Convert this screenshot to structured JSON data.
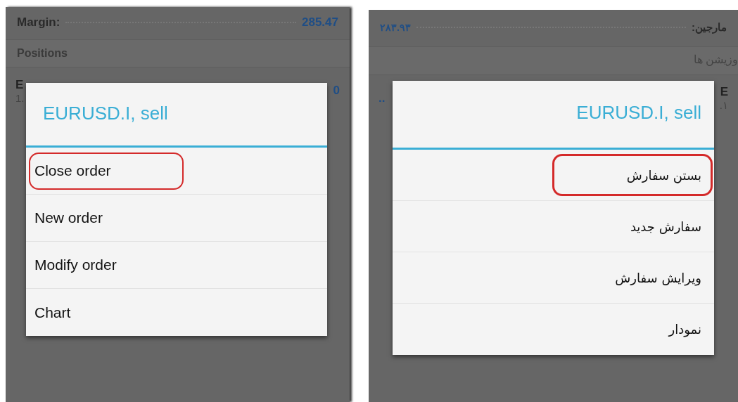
{
  "english_screen": {
    "rtl": false,
    "margin": {
      "label": "Margin:",
      "value": "285.47"
    },
    "positions_header": "Positions",
    "position_row": {
      "symbol_fragment": "E",
      "price_fragment": "1.",
      "value_fragment": "0"
    },
    "dialog": {
      "title": "EURUSD.I, sell",
      "items": [
        {
          "label": "Close order",
          "selected": true
        },
        {
          "label": "New order",
          "selected": false
        },
        {
          "label": "Modify order",
          "selected": false
        },
        {
          "label": "Chart",
          "selected": false
        }
      ]
    }
  },
  "persian_screen": {
    "rtl": true,
    "margin": {
      "label": "مارجین:",
      "value": "۲۸۳.۹۳"
    },
    "positions_header": "وزیشن ها",
    "position_row": {
      "symbol_fragment": "E",
      "price_fragment": "۱.",
      "value_fragment": ".."
    },
    "dialog": {
      "title": "EURUSD.I, sell",
      "items": [
        {
          "label": "بستن سفارش",
          "selected": true
        },
        {
          "label": "سفارش جدید",
          "selected": false
        },
        {
          "label": "ویرایش سفارش",
          "selected": false
        },
        {
          "label": "نمودار",
          "selected": false
        }
      ]
    }
  }
}
